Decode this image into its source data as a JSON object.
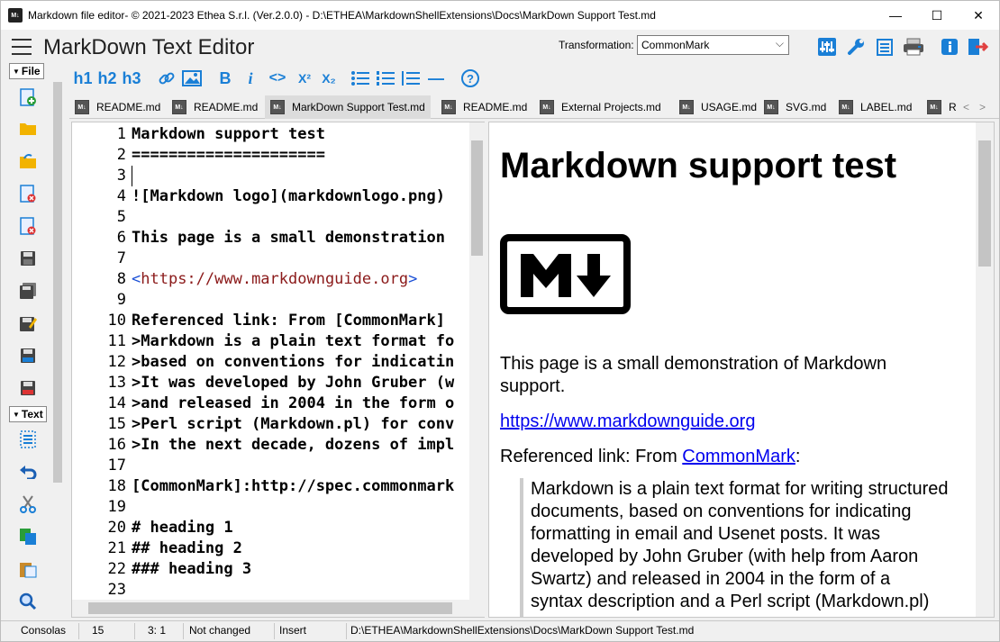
{
  "window": {
    "title": "Markdown file editor- © 2021-2023 Ethea S.r.l. (Ver.2.0.0) - D:\\ETHEA\\MarkdownShellExtensions\\Docs\\MarkDown Support Test.md",
    "minimize": "—",
    "maximize": "☐",
    "close": "✕"
  },
  "header": {
    "app_title": "MarkDown Text Editor",
    "transformation_label": "Transformation:",
    "transformation_value": "CommonMark"
  },
  "toolbar": {
    "h1": "h1",
    "h2": "h2",
    "h3": "h3",
    "bold": "B",
    "italic": "i",
    "code": "<>",
    "sup": "X²",
    "sub": "X₂",
    "hr": "—",
    "help": "?"
  },
  "tabs": [
    {
      "label": "README.md"
    },
    {
      "label": "README.md"
    },
    {
      "label": "MarkDown Support Test.md"
    },
    {
      "label": "README.md"
    },
    {
      "label": "External Projects.md"
    },
    {
      "label": "USAGE.md"
    },
    {
      "label": "SVG.md"
    },
    {
      "label": "LABEL.md"
    },
    {
      "label": "R"
    }
  ],
  "tab_nav": {
    "prev": "<",
    "next": ">"
  },
  "sidebar": {
    "file_section": "File",
    "text_section": "Text"
  },
  "editor": {
    "line_numbers": [
      "1",
      "2",
      "3",
      "4",
      "5",
      "6",
      "7",
      "8",
      "9",
      "10",
      "11",
      "12",
      "13",
      "14",
      "15",
      "16",
      "17",
      "18",
      "19",
      "20",
      "21",
      "22",
      "23"
    ],
    "lines": [
      "Markdown support test",
      "=====================",
      "",
      "![Markdown logo](markdownlogo.png)",
      "",
      "This page is a small demonstration",
      "",
      "",
      "",
      "Referenced link: From [CommonMark]",
      ">Markdown is a plain text format fo",
      ">based on conventions for indicatin",
      ">It was developed by John Gruber (w",
      ">and released in 2004 in the form o",
      ">Perl script (Markdown.pl) for conv",
      ">In the next decade, dozens of impl",
      "",
      "[CommonMark]:http://spec.commonmark",
      "",
      "# heading 1",
      "## heading 2",
      "### heading 3",
      ""
    ],
    "url_line": {
      "open": "<",
      "url": "https://www.markdownguide.org",
      "close": ">"
    }
  },
  "preview": {
    "heading": "Markdown support test",
    "logo_text": "M↓",
    "para1_line1": "This page is a small demonstration of Markdown",
    "para1_line2": "support.",
    "link": "https://www.markdownguide.org",
    "ref_prefix": "Referenced link: From ",
    "ref_link": "CommonMark",
    "ref_suffix": ":",
    "quote_lines": [
      "Markdown is a plain text format for writing structured",
      "documents, based on conventions for indicating",
      "formatting in email and Usenet posts. It was",
      "developed by John Gruber (with help from Aaron",
      "Swartz) and released in 2004 in the form of a",
      "syntax description and a Perl script (Markdown.pl)"
    ]
  },
  "status": {
    "font": "Consolas",
    "size": "15",
    "position": "3: 1",
    "modified": "Not changed",
    "mode": "Insert",
    "path": "D:\\ETHEA\\MarkdownShellExtensions\\Docs\\MarkDown Support Test.md"
  },
  "colors": {
    "accent": "#1a7fd6",
    "url": "#8b1a1a",
    "link": "#0000ee"
  }
}
